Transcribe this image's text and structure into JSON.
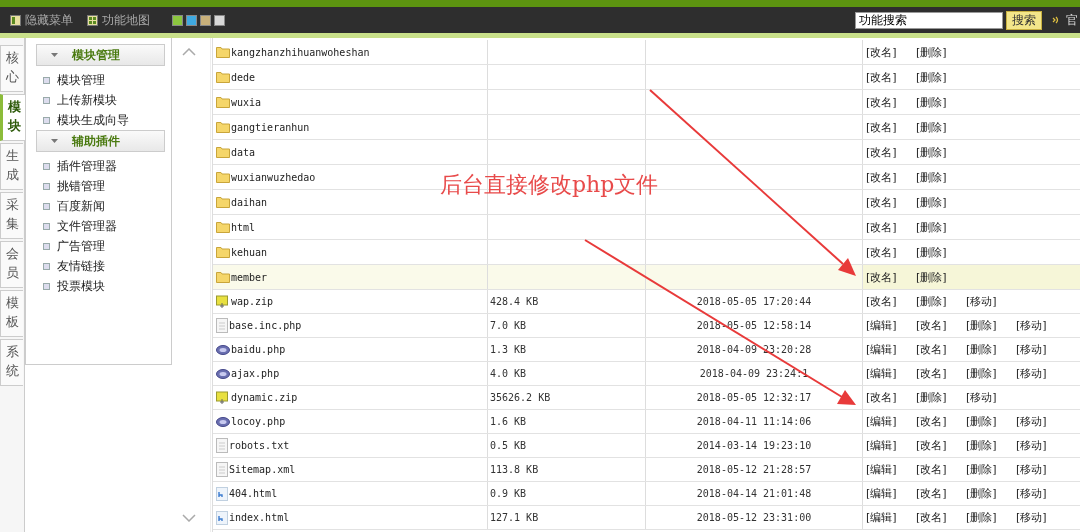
{
  "toolbar": {
    "links": [
      {
        "label": "隐藏菜单",
        "kind": "panel"
      },
      {
        "label": "功能地图",
        "kind": "grid"
      }
    ],
    "skins": [
      {
        "color": "#8cc63f"
      },
      {
        "color": "#3fa9e0"
      },
      {
        "color": "#c8b07a"
      },
      {
        "color": "#d8d8d8"
      }
    ],
    "search": {
      "value": "功能搜索",
      "button": "搜索"
    },
    "right_text": "官"
  },
  "side_tabs": [
    {
      "label": "核心",
      "selected": false
    },
    {
      "label": "模块",
      "selected": true
    },
    {
      "label": "生成",
      "selected": false
    },
    {
      "label": "采集",
      "selected": false
    },
    {
      "label": "会员",
      "selected": false
    },
    {
      "label": "模板",
      "selected": false
    },
    {
      "label": "系统",
      "selected": false
    }
  ],
  "menu": [
    {
      "title": "模块管理",
      "items": [
        "模块管理",
        "上传新模块",
        "模块生成向导"
      ]
    },
    {
      "title": "辅助插件",
      "items": [
        "插件管理器",
        "挑错管理",
        "百度新闻",
        "文件管理器",
        "广告管理",
        "友情链接",
        "投票模块"
      ]
    }
  ],
  "files": [
    {
      "kind": "folder",
      "name": "kangzhanzhihuanwoheshan",
      "hovered": false,
      "actions": [
        "[改名]",
        "[删除]"
      ]
    },
    {
      "kind": "folder",
      "name": "dede",
      "hovered": false,
      "actions": [
        "[改名]",
        "[删除]"
      ]
    },
    {
      "kind": "folder",
      "name": "wuxia",
      "hovered": false,
      "actions": [
        "[改名]",
        "[删除]"
      ]
    },
    {
      "kind": "folder",
      "name": "gangtieranhun",
      "hovered": false,
      "actions": [
        "[改名]",
        "[删除]"
      ]
    },
    {
      "kind": "folder",
      "name": "data",
      "hovered": false,
      "actions": [
        "[改名]",
        "[删除]"
      ]
    },
    {
      "kind": "folder",
      "name": "wuxianwuzhedao",
      "hovered": false,
      "actions": [
        "[改名]",
        "[删除]"
      ]
    },
    {
      "kind": "folder",
      "name": "daihan",
      "hovered": false,
      "actions": [
        "[改名]",
        "[删除]"
      ]
    },
    {
      "kind": "folder",
      "name": "html",
      "hovered": false,
      "actions": [
        "[改名]",
        "[删除]"
      ]
    },
    {
      "kind": "folder",
      "name": "kehuan",
      "hovered": false,
      "actions": [
        "[改名]",
        "[删除]"
      ]
    },
    {
      "kind": "folder",
      "name": "member",
      "hovered": true,
      "actions": [
        "[改名]",
        "[删除]"
      ]
    },
    {
      "kind": "zip",
      "name": "wap.zip",
      "size": "428.4 KB",
      "time": "2018-05-05 17:20:44",
      "hovered": false,
      "actions": [
        "[改名]",
        "[删除]",
        "[移动]"
      ]
    },
    {
      "kind": "text",
      "name": "base.inc.php",
      "size": "7.0 KB",
      "time": "2018-05-05 12:58:14",
      "hovered": false,
      "actions": [
        "[编辑]",
        "[改名]",
        "[删除]",
        "[移动]"
      ]
    },
    {
      "kind": "php",
      "name": "baidu.php",
      "size": "1.3 KB",
      "time": "2018-04-09 23:20:28",
      "hovered": false,
      "actions": [
        "[编辑]",
        "[改名]",
        "[删除]",
        "[移动]"
      ]
    },
    {
      "kind": "php",
      "name": "ajax.php",
      "size": "4.0 KB",
      "time": "2018-04-09 23:24:1",
      "hovered": false,
      "actions": [
        "[编辑]",
        "[改名]",
        "[删除]",
        "[移动]"
      ]
    },
    {
      "kind": "zip",
      "name": "dynamic.zip",
      "size": "35626.2 KB",
      "time": "2018-05-05 12:32:17",
      "hovered": false,
      "actions": [
        "[改名]",
        "[删除]",
        "[移动]"
      ]
    },
    {
      "kind": "php",
      "name": "locoy.php",
      "size": "1.6 KB",
      "time": "2018-04-11 11:14:06",
      "hovered": false,
      "actions": [
        "[编辑]",
        "[改名]",
        "[删除]",
        "[移动]"
      ]
    },
    {
      "kind": "text",
      "name": "robots.txt",
      "size": "0.5 KB",
      "time": "2014-03-14 19:23:10",
      "hovered": false,
      "actions": [
        "[编辑]",
        "[改名]",
        "[删除]",
        "[移动]"
      ]
    },
    {
      "kind": "text",
      "name": "Sitemap.xml",
      "size": "113.8 KB",
      "time": "2018-05-12 21:28:57",
      "hovered": false,
      "actions": [
        "[编辑]",
        "[改名]",
        "[删除]",
        "[移动]"
      ]
    },
    {
      "kind": "html",
      "name": "404.html",
      "size": "0.9 KB",
      "time": "2018-04-14 21:01:48",
      "hovered": false,
      "actions": [
        "[编辑]",
        "[改名]",
        "[删除]",
        "[移动]"
      ]
    },
    {
      "kind": "html",
      "name": "index.html",
      "size": "127.1 KB",
      "time": "2018-05-12 23:31:00",
      "hovered": false,
      "actions": [
        "[编辑]",
        "[改名]",
        "[删除]",
        "[移动]"
      ]
    }
  ],
  "annotation": {
    "text": "后台直接修改php文件"
  }
}
